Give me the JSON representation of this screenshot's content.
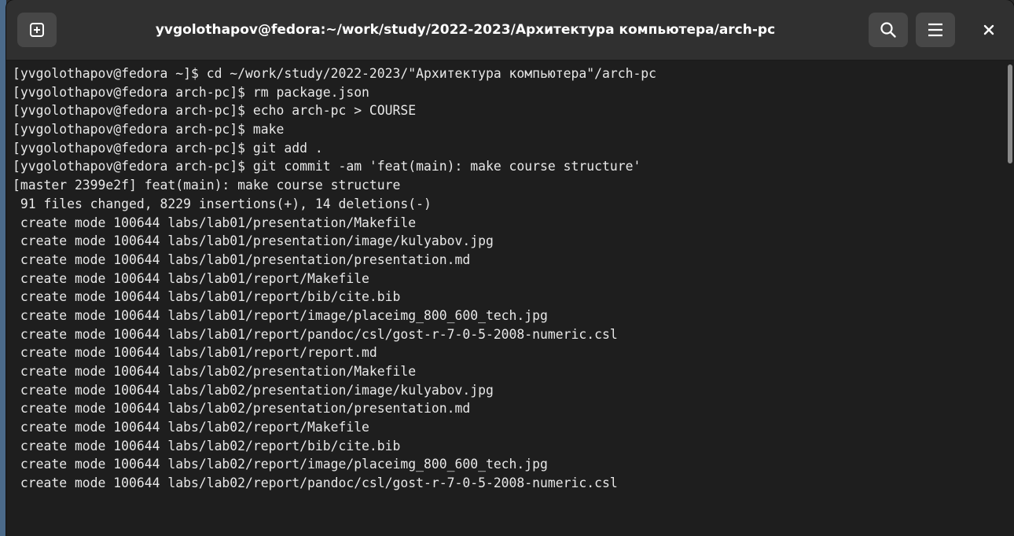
{
  "window": {
    "title": "yvgolothapov@fedora:~/work/study/2022-2023/Архитектура компьютера/arch-pc"
  },
  "titlebar": {
    "new_tab_icon": "new-tab-icon",
    "search_icon": "search-icon",
    "menu_icon": "hamburger-menu-icon",
    "close_icon": "close-icon",
    "close_label": "×"
  },
  "terminal": {
    "lines": [
      "[yvgolothapov@fedora ~]$ cd ~/work/study/2022-2023/\"Архитектура компьютера\"/arch-pc",
      "[yvgolothapov@fedora arch-pc]$ rm package.json",
      "[yvgolothapov@fedora arch-pc]$ echo arch-pc > COURSE",
      "[yvgolothapov@fedora arch-pc]$ make",
      "[yvgolothapov@fedora arch-pc]$ git add .",
      "[yvgolothapov@fedora arch-pc]$ git commit -am 'feat(main): make course structure'",
      "[master 2399e2f] feat(main): make course structure",
      " 91 files changed, 8229 insertions(+), 14 deletions(-)",
      " create mode 100644 labs/lab01/presentation/Makefile",
      " create mode 100644 labs/lab01/presentation/image/kulyabov.jpg",
      " create mode 100644 labs/lab01/presentation/presentation.md",
      " create mode 100644 labs/lab01/report/Makefile",
      " create mode 100644 labs/lab01/report/bib/cite.bib",
      " create mode 100644 labs/lab01/report/image/placeimg_800_600_tech.jpg",
      " create mode 100644 labs/lab01/report/pandoc/csl/gost-r-7-0-5-2008-numeric.csl",
      " create mode 100644 labs/lab01/report/report.md",
      " create mode 100644 labs/lab02/presentation/Makefile",
      " create mode 100644 labs/lab02/presentation/image/kulyabov.jpg",
      " create mode 100644 labs/lab02/presentation/presentation.md",
      " create mode 100644 labs/lab02/report/Makefile",
      " create mode 100644 labs/lab02/report/bib/cite.bib",
      " create mode 100644 labs/lab02/report/image/placeimg_800_600_tech.jpg",
      " create mode 100644 labs/lab02/report/pandoc/csl/gost-r-7-0-5-2008-numeric.csl"
    ]
  },
  "colors": {
    "titlebar_bg": "#303030",
    "terminal_bg": "#1e1e1e",
    "text": "#e8e8e8",
    "button_bg": "#474747"
  }
}
